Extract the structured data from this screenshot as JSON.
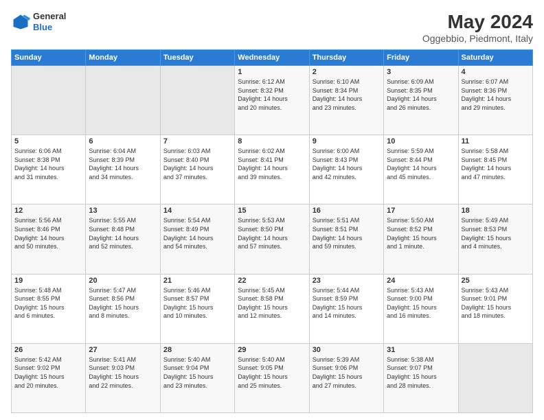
{
  "logo": {
    "line1": "General",
    "line2": "Blue"
  },
  "title": "May 2024",
  "subtitle": "Oggebbio, Piedmont, Italy",
  "header_days": [
    "Sunday",
    "Monday",
    "Tuesday",
    "Wednesday",
    "Thursday",
    "Friday",
    "Saturday"
  ],
  "weeks": [
    [
      {
        "day": "",
        "info": ""
      },
      {
        "day": "",
        "info": ""
      },
      {
        "day": "",
        "info": ""
      },
      {
        "day": "1",
        "info": "Sunrise: 6:12 AM\nSunset: 8:32 PM\nDaylight: 14 hours\nand 20 minutes."
      },
      {
        "day": "2",
        "info": "Sunrise: 6:10 AM\nSunset: 8:34 PM\nDaylight: 14 hours\nand 23 minutes."
      },
      {
        "day": "3",
        "info": "Sunrise: 6:09 AM\nSunset: 8:35 PM\nDaylight: 14 hours\nand 26 minutes."
      },
      {
        "day": "4",
        "info": "Sunrise: 6:07 AM\nSunset: 8:36 PM\nDaylight: 14 hours\nand 29 minutes."
      }
    ],
    [
      {
        "day": "5",
        "info": "Sunrise: 6:06 AM\nSunset: 8:38 PM\nDaylight: 14 hours\nand 31 minutes."
      },
      {
        "day": "6",
        "info": "Sunrise: 6:04 AM\nSunset: 8:39 PM\nDaylight: 14 hours\nand 34 minutes."
      },
      {
        "day": "7",
        "info": "Sunrise: 6:03 AM\nSunset: 8:40 PM\nDaylight: 14 hours\nand 37 minutes."
      },
      {
        "day": "8",
        "info": "Sunrise: 6:02 AM\nSunset: 8:41 PM\nDaylight: 14 hours\nand 39 minutes."
      },
      {
        "day": "9",
        "info": "Sunrise: 6:00 AM\nSunset: 8:43 PM\nDaylight: 14 hours\nand 42 minutes."
      },
      {
        "day": "10",
        "info": "Sunrise: 5:59 AM\nSunset: 8:44 PM\nDaylight: 14 hours\nand 45 minutes."
      },
      {
        "day": "11",
        "info": "Sunrise: 5:58 AM\nSunset: 8:45 PM\nDaylight: 14 hours\nand 47 minutes."
      }
    ],
    [
      {
        "day": "12",
        "info": "Sunrise: 5:56 AM\nSunset: 8:46 PM\nDaylight: 14 hours\nand 50 minutes."
      },
      {
        "day": "13",
        "info": "Sunrise: 5:55 AM\nSunset: 8:48 PM\nDaylight: 14 hours\nand 52 minutes."
      },
      {
        "day": "14",
        "info": "Sunrise: 5:54 AM\nSunset: 8:49 PM\nDaylight: 14 hours\nand 54 minutes."
      },
      {
        "day": "15",
        "info": "Sunrise: 5:53 AM\nSunset: 8:50 PM\nDaylight: 14 hours\nand 57 minutes."
      },
      {
        "day": "16",
        "info": "Sunrise: 5:51 AM\nSunset: 8:51 PM\nDaylight: 14 hours\nand 59 minutes."
      },
      {
        "day": "17",
        "info": "Sunrise: 5:50 AM\nSunset: 8:52 PM\nDaylight: 15 hours\nand 1 minute."
      },
      {
        "day": "18",
        "info": "Sunrise: 5:49 AM\nSunset: 8:53 PM\nDaylight: 15 hours\nand 4 minutes."
      }
    ],
    [
      {
        "day": "19",
        "info": "Sunrise: 5:48 AM\nSunset: 8:55 PM\nDaylight: 15 hours\nand 6 minutes."
      },
      {
        "day": "20",
        "info": "Sunrise: 5:47 AM\nSunset: 8:56 PM\nDaylight: 15 hours\nand 8 minutes."
      },
      {
        "day": "21",
        "info": "Sunrise: 5:46 AM\nSunset: 8:57 PM\nDaylight: 15 hours\nand 10 minutes."
      },
      {
        "day": "22",
        "info": "Sunrise: 5:45 AM\nSunset: 8:58 PM\nDaylight: 15 hours\nand 12 minutes."
      },
      {
        "day": "23",
        "info": "Sunrise: 5:44 AM\nSunset: 8:59 PM\nDaylight: 15 hours\nand 14 minutes."
      },
      {
        "day": "24",
        "info": "Sunrise: 5:43 AM\nSunset: 9:00 PM\nDaylight: 15 hours\nand 16 minutes."
      },
      {
        "day": "25",
        "info": "Sunrise: 5:43 AM\nSunset: 9:01 PM\nDaylight: 15 hours\nand 18 minutes."
      }
    ],
    [
      {
        "day": "26",
        "info": "Sunrise: 5:42 AM\nSunset: 9:02 PM\nDaylight: 15 hours\nand 20 minutes."
      },
      {
        "day": "27",
        "info": "Sunrise: 5:41 AM\nSunset: 9:03 PM\nDaylight: 15 hours\nand 22 minutes."
      },
      {
        "day": "28",
        "info": "Sunrise: 5:40 AM\nSunset: 9:04 PM\nDaylight: 15 hours\nand 23 minutes."
      },
      {
        "day": "29",
        "info": "Sunrise: 5:40 AM\nSunset: 9:05 PM\nDaylight: 15 hours\nand 25 minutes."
      },
      {
        "day": "30",
        "info": "Sunrise: 5:39 AM\nSunset: 9:06 PM\nDaylight: 15 hours\nand 27 minutes."
      },
      {
        "day": "31",
        "info": "Sunrise: 5:38 AM\nSunset: 9:07 PM\nDaylight: 15 hours\nand 28 minutes."
      },
      {
        "day": "",
        "info": ""
      }
    ]
  ]
}
